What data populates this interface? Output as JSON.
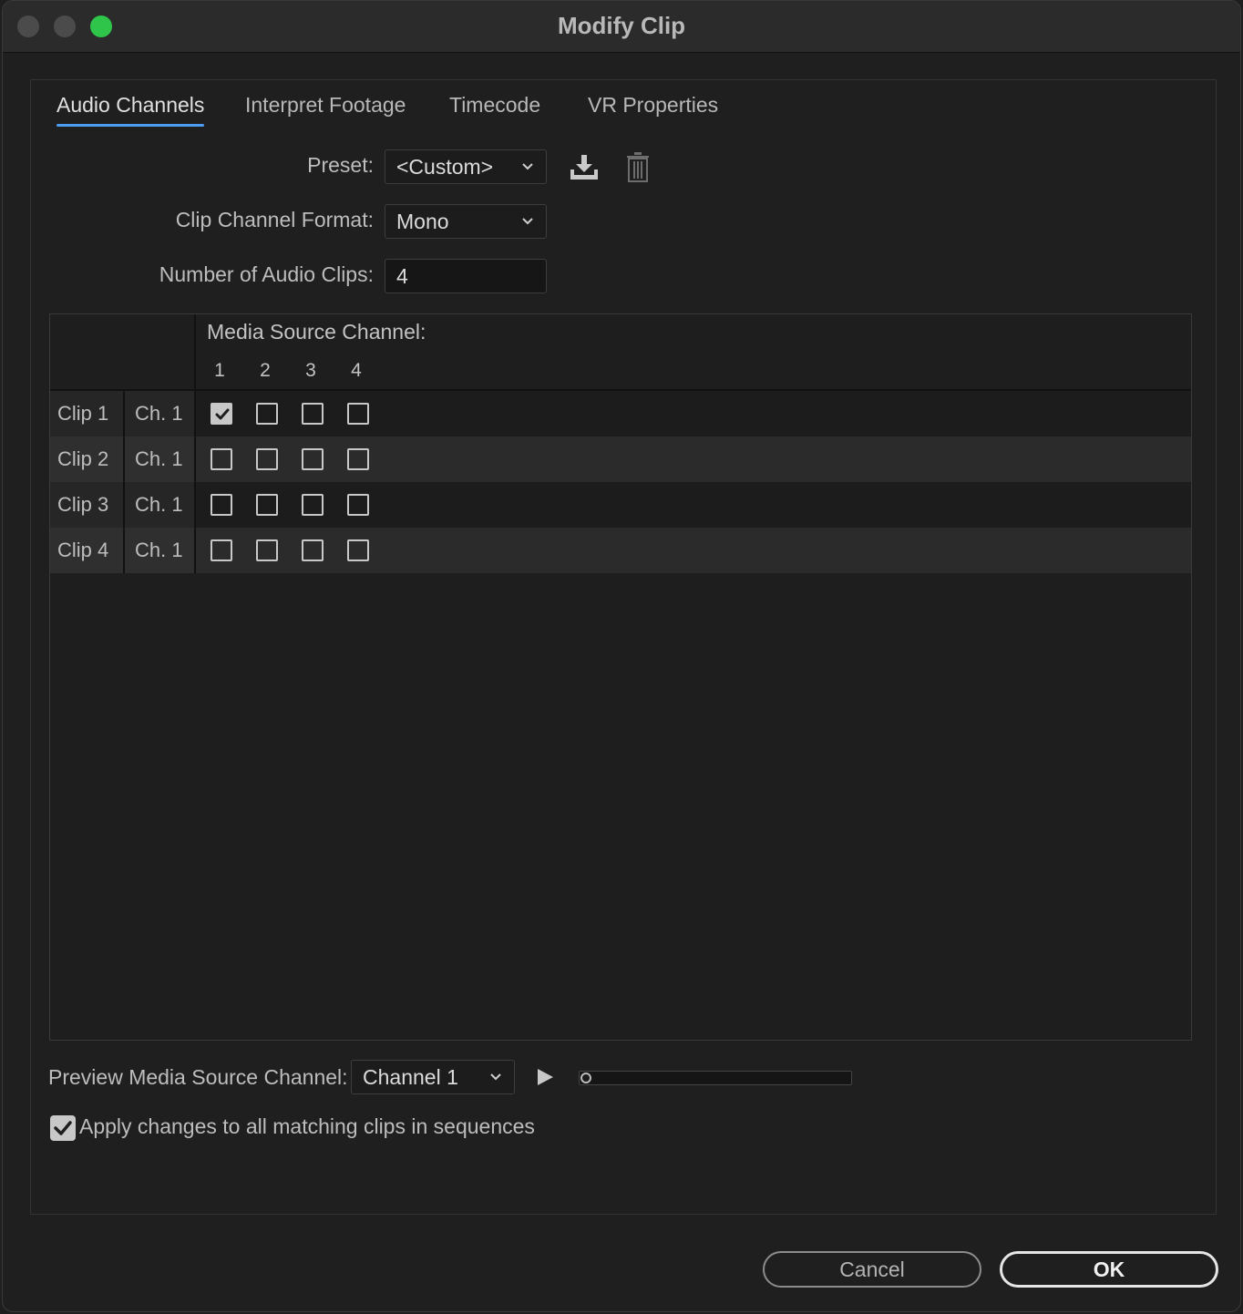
{
  "window": {
    "title": "Modify Clip"
  },
  "tabs": [
    {
      "label": "Audio Channels",
      "active": true
    },
    {
      "label": "Interpret Footage",
      "active": false
    },
    {
      "label": "Timecode",
      "active": false
    },
    {
      "label": "VR Properties",
      "active": false
    }
  ],
  "form": {
    "preset_label": "Preset:",
    "preset_value": "<Custom>",
    "clip_channel_format_label": "Clip Channel Format:",
    "clip_channel_format_value": "Mono",
    "number_of_audio_clips_label": "Number of Audio Clips:",
    "number_of_audio_clips_value": "4"
  },
  "icons": {
    "save_preset": "download-icon",
    "delete_preset": "trash-icon"
  },
  "matrix": {
    "header": "Media Source Channel:",
    "columns": [
      "1",
      "2",
      "3",
      "4"
    ],
    "rows": [
      {
        "clip": "Clip 1",
        "channel": "Ch. 1",
        "checks": [
          true,
          false,
          false,
          false
        ]
      },
      {
        "clip": "Clip 2",
        "channel": "Ch. 1",
        "checks": [
          false,
          false,
          false,
          false
        ]
      },
      {
        "clip": "Clip 3",
        "channel": "Ch. 1",
        "checks": [
          false,
          false,
          false,
          false
        ]
      },
      {
        "clip": "Clip 4",
        "channel": "Ch. 1",
        "checks": [
          false,
          false,
          false,
          false
        ]
      }
    ]
  },
  "preview": {
    "label": "Preview Media Source Channel:",
    "channel_value": "Channel 1",
    "progress": 0
  },
  "apply": {
    "label": "Apply changes to all matching clips in sequences",
    "checked": true
  },
  "buttons": {
    "cancel": "Cancel",
    "ok": "OK"
  },
  "colors": {
    "accent": "#4d9df5",
    "max_button": "#2fc44a"
  }
}
